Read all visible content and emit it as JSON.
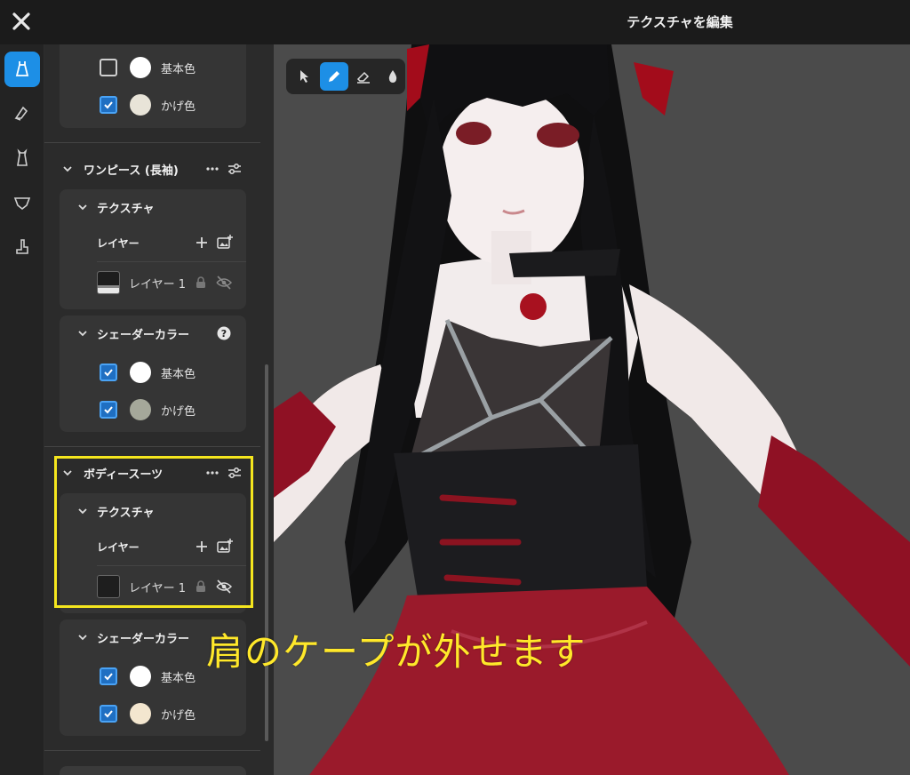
{
  "window": {
    "title": "テクスチャを編集"
  },
  "panel": {
    "top_card": {
      "base_color": {
        "label": "基本色",
        "checked": false,
        "swatch": "#ffffff"
      },
      "shade_color": {
        "label": "かげ色",
        "checked": true,
        "swatch": "#e8e4d8"
      }
    },
    "sections": [
      {
        "title": "ワンピース (長袖)",
        "texture": {
          "title": "テクスチャ",
          "layers_label": "レイヤー",
          "layer_name": "レイヤー 1"
        },
        "shader": {
          "title": "シェーダーカラー",
          "base_color": {
            "label": "基本色",
            "checked": true,
            "swatch": "#ffffff"
          },
          "shade_color": {
            "label": "かげ色",
            "checked": true,
            "swatch": "#a5a89a"
          }
        }
      },
      {
        "title": "ボディースーツ",
        "texture": {
          "title": "テクスチャ",
          "layers_label": "レイヤー",
          "layer_name": "レイヤー 1"
        },
        "shader": {
          "title": "シェーダーカラー",
          "base_color": {
            "label": "基本色",
            "checked": true,
            "swatch": "#ffffff"
          },
          "shade_color": {
            "label": "かげ色",
            "checked": true,
            "swatch": "#f3e6cf"
          }
        }
      }
    ]
  },
  "annotation": {
    "caption": "肩のケープが外せます",
    "highlight_color": "#f5e61e"
  },
  "colors": {
    "accent": "#1d8fe6",
    "panel_bg": "#2b2b2b",
    "card_bg": "#353535",
    "viewport_bg": "#4b4b4b"
  }
}
